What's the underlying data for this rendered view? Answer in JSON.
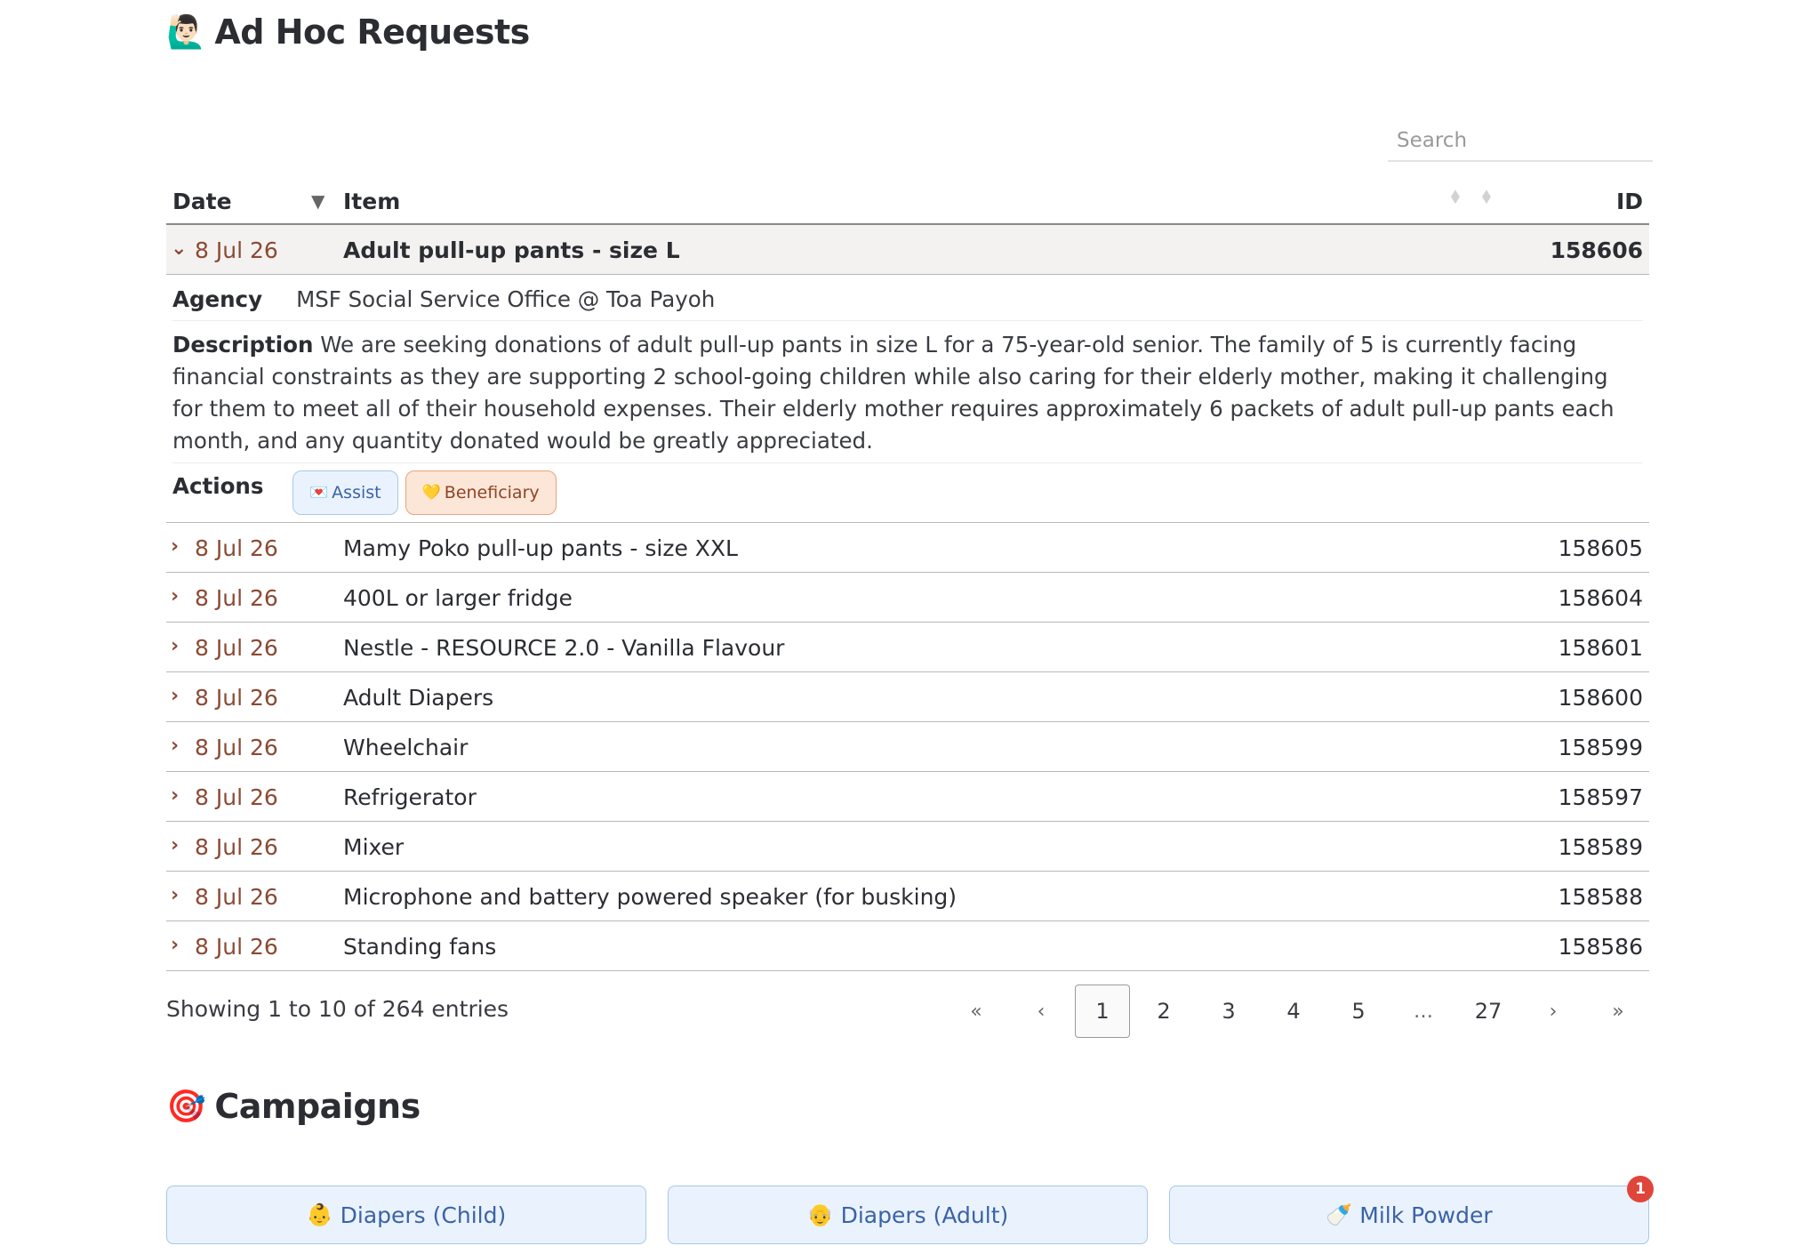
{
  "adhoc": {
    "title_emoji": "🙋🏻‍♂️",
    "title": "Ad Hoc Requests",
    "search_placeholder": "Search",
    "columns": {
      "date": "Date",
      "item": "Item",
      "id": "ID"
    },
    "expanded_row": {
      "date": "8 Jul 26",
      "item": "Adult pull-up pants - size L",
      "id": "158606",
      "agency_label": "Agency",
      "agency": "MSF Social Service Office @ Toa Payoh",
      "description_label": "Description",
      "description": "We are seeking donations of adult pull-up pants in size L for a 75-year-old senior. The family of 5 is currently facing financial constraints as they are supporting 2 school-going children while also caring for their elderly mother, making it challenging for them to meet all of their household expenses. Their elderly mother requires approximately 6 packets of adult pull-up pants each month, and any quantity donated would be greatly appreciated.",
      "actions_label": "Actions",
      "assist_label": "Assist",
      "beneficiary_label": "Beneficiary"
    },
    "rows": [
      {
        "date": "8 Jul 26",
        "item": "Mamy Poko pull-up pants - size XXL",
        "id": "158605"
      },
      {
        "date": "8 Jul 26",
        "item": "400L or larger fridge",
        "id": "158604"
      },
      {
        "date": "8 Jul 26",
        "item": "Nestle - RESOURCE 2.0 - Vanilla Flavour",
        "id": "158601"
      },
      {
        "date": "8 Jul 26",
        "item": "Adult Diapers",
        "id": "158600"
      },
      {
        "date": "8 Jul 26",
        "item": "Wheelchair",
        "id": "158599"
      },
      {
        "date": "8 Jul 26",
        "item": "Refrigerator",
        "id": "158597"
      },
      {
        "date": "8 Jul 26",
        "item": "Mixer",
        "id": "158589"
      },
      {
        "date": "8 Jul 26",
        "item": "Microphone and battery powered speaker (for busking)",
        "id": "158588"
      },
      {
        "date": "8 Jul 26",
        "item": "Standing fans",
        "id": "158586"
      }
    ],
    "showing": "Showing 1 to 10 of 264 entries",
    "pagination": {
      "first": "«",
      "prev": "‹",
      "pages": [
        "1",
        "2",
        "3",
        "4",
        "5"
      ],
      "ellipsis": "…",
      "last_page": "27",
      "next": "›",
      "last": "»",
      "current": "1"
    }
  },
  "campaigns": {
    "title_emoji": "🎯",
    "title": "Campaigns",
    "items": [
      {
        "emoji": "👶",
        "label": "Diapers (Child)",
        "badge": ""
      },
      {
        "emoji": "👴",
        "label": "Diapers (Adult)",
        "badge": ""
      },
      {
        "emoji": "🍼",
        "label": "Milk Powder",
        "badge": "1"
      }
    ]
  },
  "colors": {
    "date_text": "#8b4a34",
    "campaign_border": "#a9c7ea",
    "badge": "#e0453a"
  }
}
